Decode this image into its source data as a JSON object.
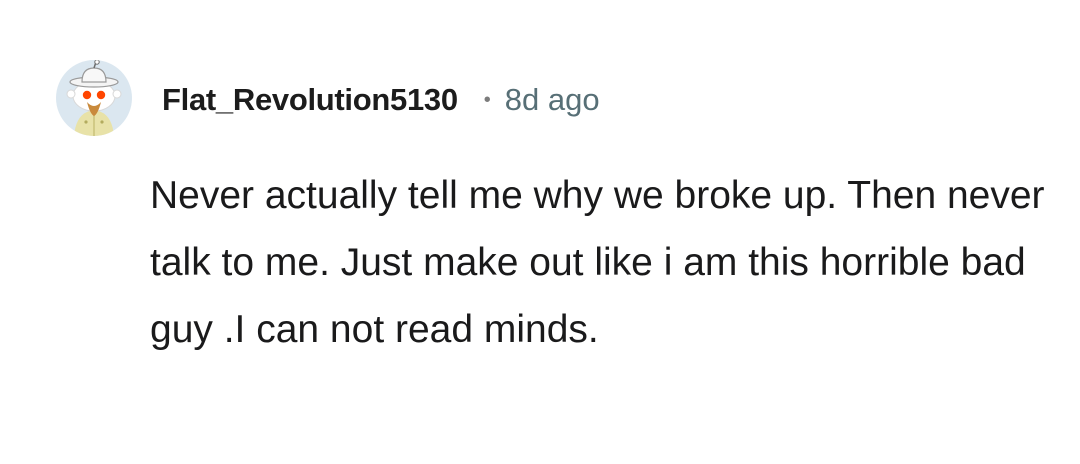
{
  "comment": {
    "avatar_icon": "snoo-avatar-icon",
    "username": "Flat_Revolution5130",
    "separator": "•",
    "timestamp": "8d ago",
    "body": "Never actually tell me why we broke up. Then never talk to me. Just make out like i am this horrible bad guy .I can not read minds."
  },
  "colors": {
    "username": "#1c1c1c",
    "timestamp": "#576f76",
    "body_text": "#1a1a1b",
    "avatar_bg": "#dbe7f0"
  }
}
